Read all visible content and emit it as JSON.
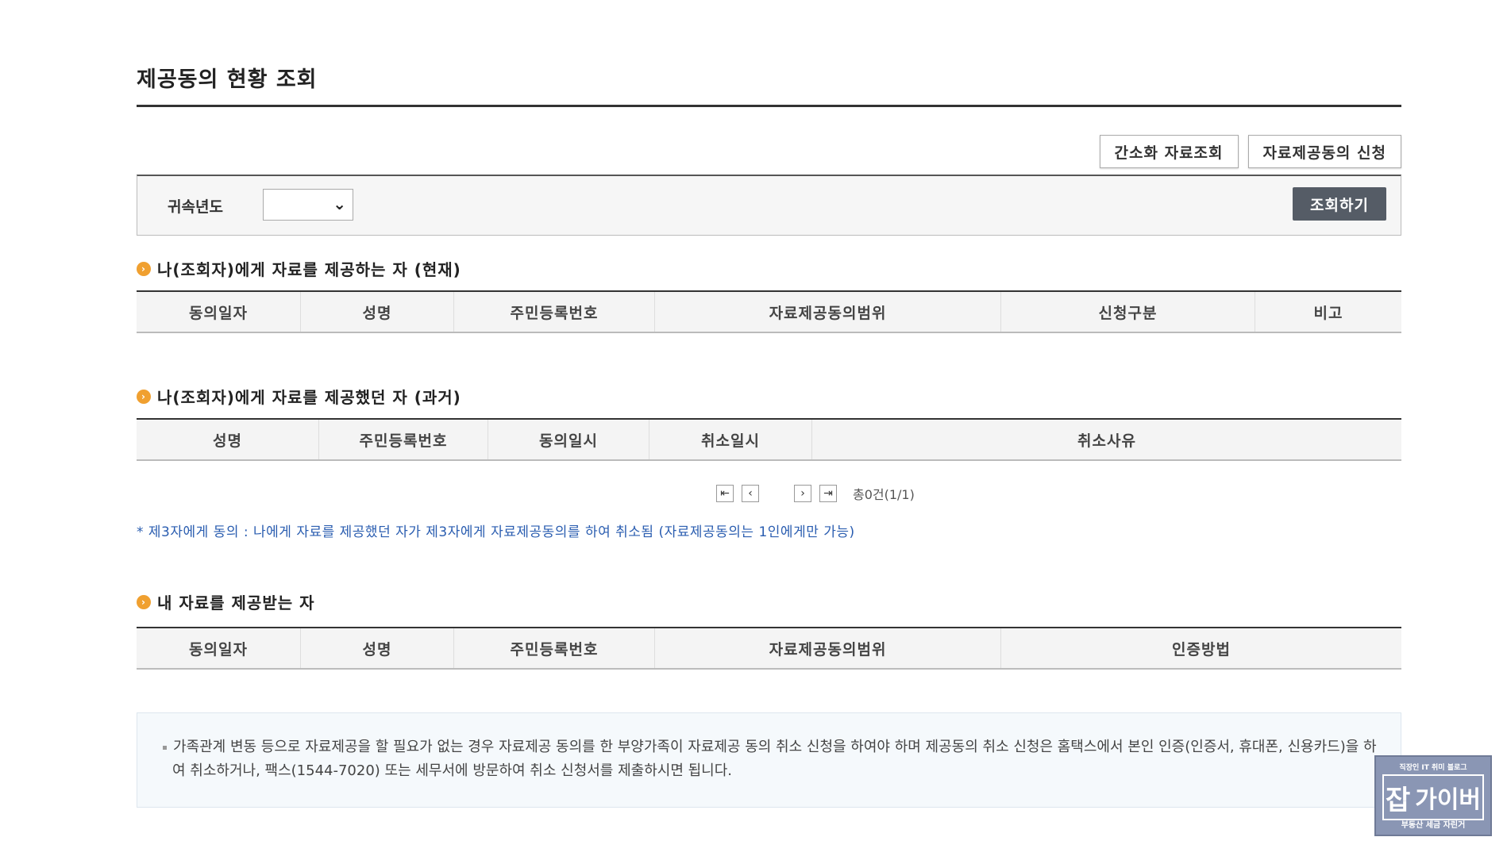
{
  "page": {
    "title": "제공동의 현황 조회"
  },
  "top_buttons": {
    "simple_lookup": "간소화 자료조회",
    "consent_apply": "자료제공동의 신청"
  },
  "search": {
    "year_label": "귀속년도",
    "year_value": "",
    "submit": "조회하기"
  },
  "section_current": {
    "title": "나(조회자)에게 자료를 제공하는 자 (현재)",
    "columns": [
      "동의일자",
      "성명",
      "주민등록번호",
      "자료제공동의범위",
      "신청구분",
      "비고"
    ]
  },
  "section_past": {
    "title": "나(조회자)에게 자료를 제공했던 자 (과거)",
    "columns": [
      "성명",
      "주민등록번호",
      "동의일시",
      "취소일시",
      "취소사유"
    ]
  },
  "pager": {
    "first_icon": "arrow-first-icon",
    "prev_icon": "chevron-left-icon",
    "next_icon": "chevron-right-icon",
    "last_icon": "arrow-last-icon",
    "total": "총0건(1/1)"
  },
  "note": "* 제3자에게 동의 : 나에게 자료를 제공했던 자가 제3자에게 자료제공동의를 하여 취소됨 (자료제공동의는 1인에게만 가능)",
  "section_receivers": {
    "title": "내 자료를 제공받는 자",
    "columns": [
      "동의일자",
      "성명",
      "주민등록번호",
      "자료제공동의범위",
      "인증방법"
    ]
  },
  "info": "가족관계 변동 등으로 자료제공을 할 필요가 없는 경우 자료제공 동의를 한 부양가족이 자료제공 동의 취소 신청을 하여야 하며 제공동의 취소 신청은 홈택스에서 본인 인증(인증서, 휴대폰, 신용카드)을 하여 취소하거나, 팩스(1544-7020) 또는 세무서에 방문하여 취소 신청서를 제출하시면 됩니다.",
  "logo": {
    "top": "직장인 IT 취미 블로그",
    "main_1": "잡",
    "main_2": "가이버",
    "bottom": "부동산 세금 자린거"
  },
  "colors": {
    "accent_bullet": "#f0a030",
    "dark_button": "#555c66",
    "note_blue": "#2a5db0"
  }
}
